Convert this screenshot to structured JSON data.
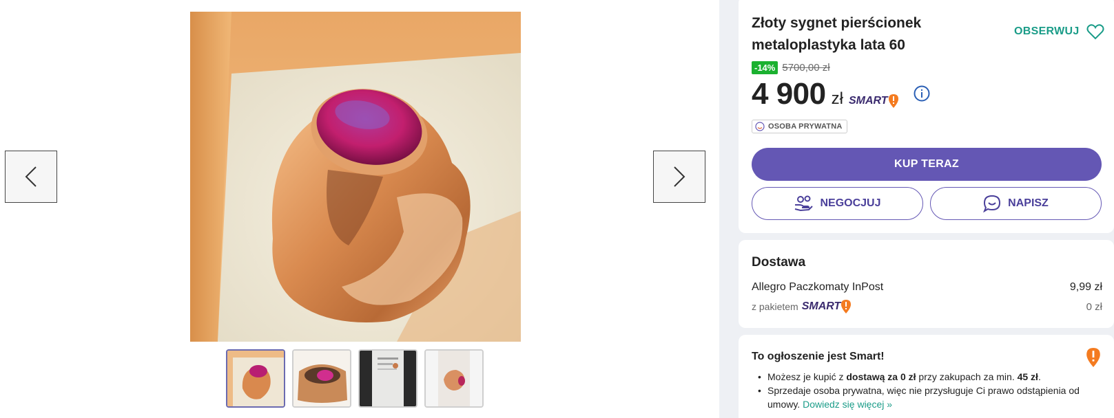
{
  "listing": {
    "title": "Złoty sygnet pierścionek metaloplastyka lata 60",
    "watch_label": "OBSERWUJ",
    "discount": "-14%",
    "old_price": "5700,00 zł",
    "price": "4 900",
    "currency": "zł",
    "smart_label": "SMART",
    "seller_type": "OSOBA PRYWATNA",
    "buy_label": "KUP TERAZ",
    "negotiate_label": "NEGOCJUJ",
    "message_label": "NAPISZ"
  },
  "delivery": {
    "title": "Dostawa",
    "method": "Allegro Paczkomaty InPost",
    "method_price": "9,99 zł",
    "package_prefix": "z pakietem",
    "package_smart": "SMART",
    "package_price": "0 zł"
  },
  "smart_info": {
    "title": "To ogłoszenie jest Smart!",
    "line1_a": "Możesz je kupić z ",
    "line1_b": "dostawą za 0 zł",
    "line1_c": " przy zakupach za min. ",
    "line1_d": "45 zł",
    "line1_e": ".",
    "line2_a": "Sprzedaje osoba prywatna, więc nie przysługuje Ci prawo odstąpienia od umowy. ",
    "line2_link": "Dowiedz się więcej »"
  },
  "gallery": {
    "thumbnail_count": 4,
    "active_index": 0
  },
  "colors": {
    "accent": "#6457b4",
    "teal": "#1a9c88",
    "discount_green": "#1bb130",
    "smart_orange": "#f47b20"
  },
  "icons": [
    "chevron-left-icon",
    "chevron-right-icon",
    "heart-icon",
    "info-icon",
    "user-icon",
    "hand-coins-icon",
    "chat-bubble-icon",
    "smart-exclamation-icon"
  ]
}
